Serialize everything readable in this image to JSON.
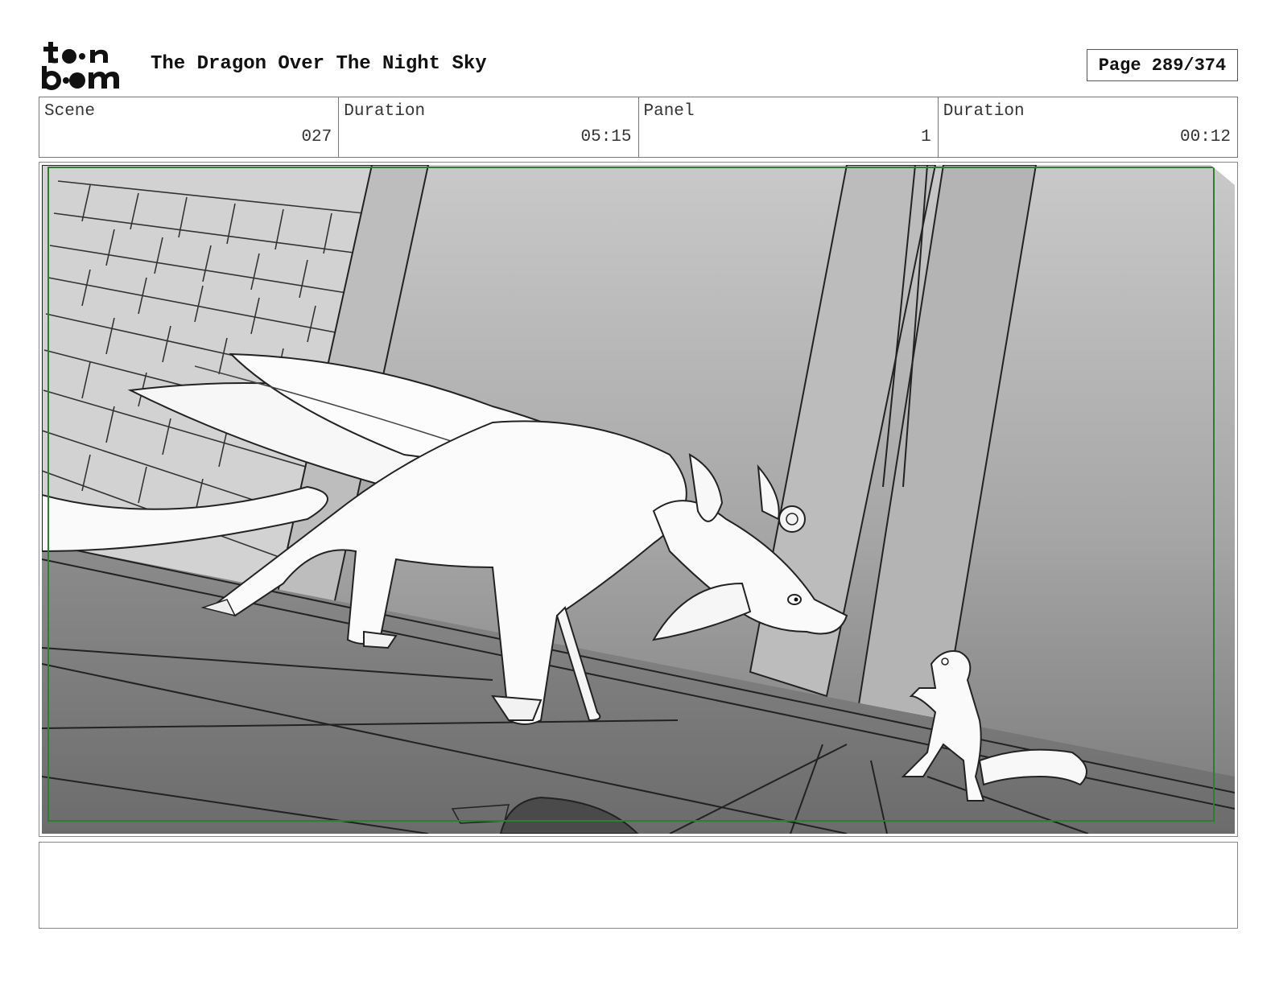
{
  "header": {
    "logo": {
      "top": "toon",
      "bottom": "boom",
      "icon": "toon-boom-logo"
    },
    "title": "The Dragon Over The Night Sky",
    "page_label": "Page 289/374"
  },
  "info": [
    {
      "label": "Scene",
      "value": "027"
    },
    {
      "label": "Duration",
      "value": "05:15"
    },
    {
      "label": "Panel",
      "value": "1"
    },
    {
      "label": "Duration",
      "value": "00:12"
    }
  ],
  "panel": {
    "safe_frame_color": "#2e7d32",
    "art": "storyboard-sketch-dragon-and-cat"
  },
  "notes": {
    "text": ""
  }
}
